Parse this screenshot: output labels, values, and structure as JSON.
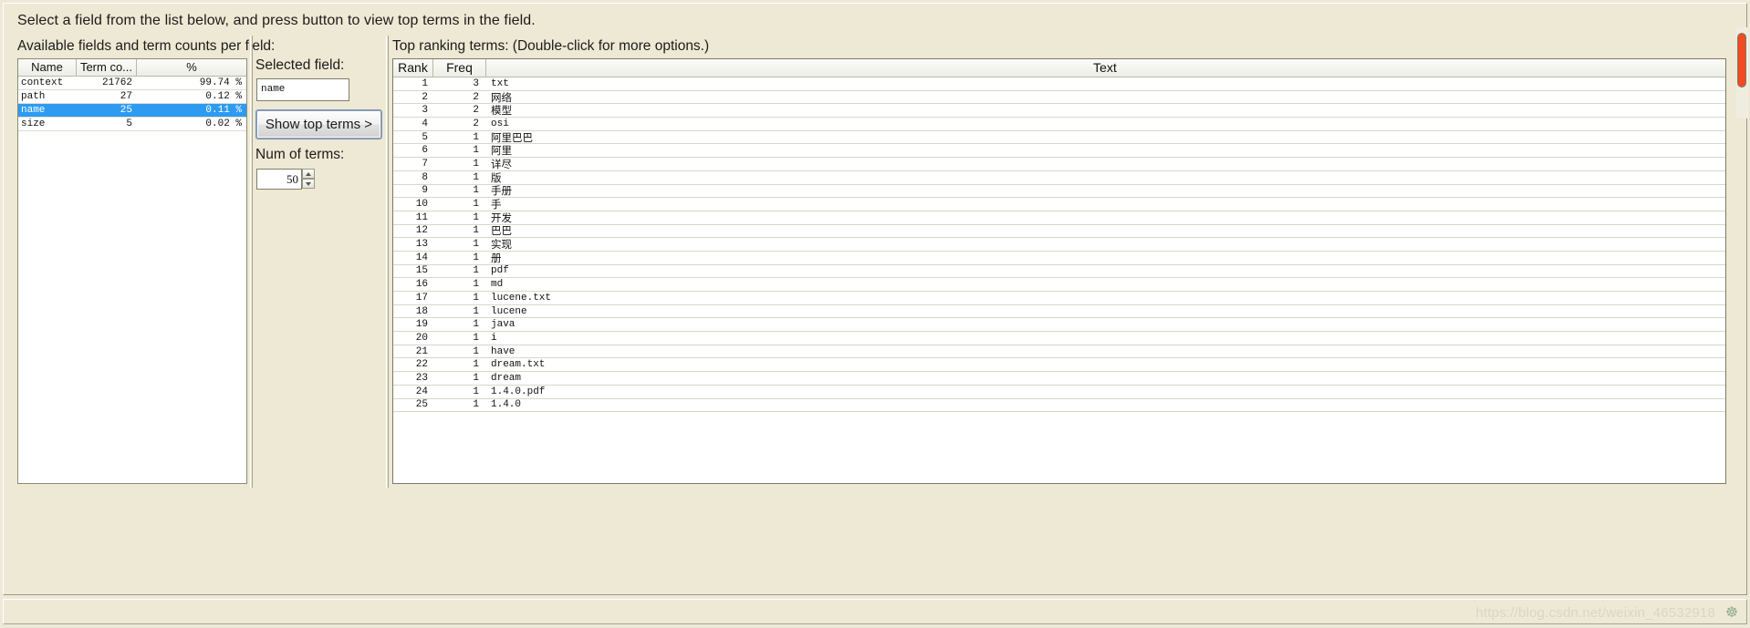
{
  "instruction": "Select a field from the list below, and press button to view top terms in the field.",
  "labels": {
    "available_fields": "Available fields and term counts per field:",
    "selected_field": "Selected field:",
    "num_of_terms": "Num of terms:",
    "top_ranking_terms": "Top ranking terms: (Double-click for more options.)"
  },
  "fields_table": {
    "columns": [
      "Name",
      "Term co...",
      "%"
    ],
    "rows": [
      {
        "name": "context",
        "count": "21762",
        "pct": "99.74 %",
        "selected": false
      },
      {
        "name": "path",
        "count": "27",
        "pct": "0.12 %",
        "selected": false
      },
      {
        "name": "name",
        "count": "25",
        "pct": "0.11 %",
        "selected": true
      },
      {
        "name": "size",
        "count": "5",
        "pct": "0.02 %",
        "selected": false
      }
    ]
  },
  "selected_field_input": {
    "value": "name",
    "placeholder": ""
  },
  "show_top_terms_button": "Show top terms >",
  "num_of_terms_spinner": {
    "value": "50",
    "up_icon": "triangle-up-icon",
    "down_icon": "triangle-down-icon"
  },
  "terms_table": {
    "columns": [
      "Rank",
      "Freq",
      "Text"
    ],
    "rows": [
      {
        "rank": "1",
        "freq": "3",
        "text": "txt",
        "cjk": false
      },
      {
        "rank": "2",
        "freq": "2",
        "text": "网络",
        "cjk": true
      },
      {
        "rank": "3",
        "freq": "2",
        "text": "模型",
        "cjk": true
      },
      {
        "rank": "4",
        "freq": "2",
        "text": "osi",
        "cjk": false
      },
      {
        "rank": "5",
        "freq": "1",
        "text": "阿里巴巴",
        "cjk": true
      },
      {
        "rank": "6",
        "freq": "1",
        "text": "阿里",
        "cjk": true
      },
      {
        "rank": "7",
        "freq": "1",
        "text": "详尽",
        "cjk": true
      },
      {
        "rank": "8",
        "freq": "1",
        "text": "版",
        "cjk": true
      },
      {
        "rank": "9",
        "freq": "1",
        "text": "手册",
        "cjk": true
      },
      {
        "rank": "10",
        "freq": "1",
        "text": "手",
        "cjk": true
      },
      {
        "rank": "11",
        "freq": "1",
        "text": "开发",
        "cjk": true
      },
      {
        "rank": "12",
        "freq": "1",
        "text": "巴巴",
        "cjk": true
      },
      {
        "rank": "13",
        "freq": "1",
        "text": "实现",
        "cjk": true
      },
      {
        "rank": "14",
        "freq": "1",
        "text": "册",
        "cjk": true
      },
      {
        "rank": "15",
        "freq": "1",
        "text": "pdf",
        "cjk": false
      },
      {
        "rank": "16",
        "freq": "1",
        "text": "md",
        "cjk": false
      },
      {
        "rank": "17",
        "freq": "1",
        "text": "lucene.txt",
        "cjk": false
      },
      {
        "rank": "18",
        "freq": "1",
        "text": "lucene",
        "cjk": false
      },
      {
        "rank": "19",
        "freq": "1",
        "text": "java",
        "cjk": false
      },
      {
        "rank": "20",
        "freq": "1",
        "text": "i",
        "cjk": false
      },
      {
        "rank": "21",
        "freq": "1",
        "text": "have",
        "cjk": false
      },
      {
        "rank": "22",
        "freq": "1",
        "text": "dream.txt",
        "cjk": false
      },
      {
        "rank": "23",
        "freq": "1",
        "text": "dream",
        "cjk": false
      },
      {
        "rank": "24",
        "freq": "1",
        "text": "1.4.0.pdf",
        "cjk": false
      },
      {
        "rank": "25",
        "freq": "1",
        "text": "1.4.0",
        "cjk": false
      }
    ]
  },
  "scrollbar": {
    "thumb_color": "#f04b23"
  },
  "status_bar": {
    "watermark": "https://blog.csdn.net/weixin_46532918",
    "logo_icon": "csdn-logo-icon"
  },
  "colors": {
    "window_background": "#eee9d4",
    "selection_blue": "#2e9bf0",
    "table_background": "#ffffff"
  }
}
